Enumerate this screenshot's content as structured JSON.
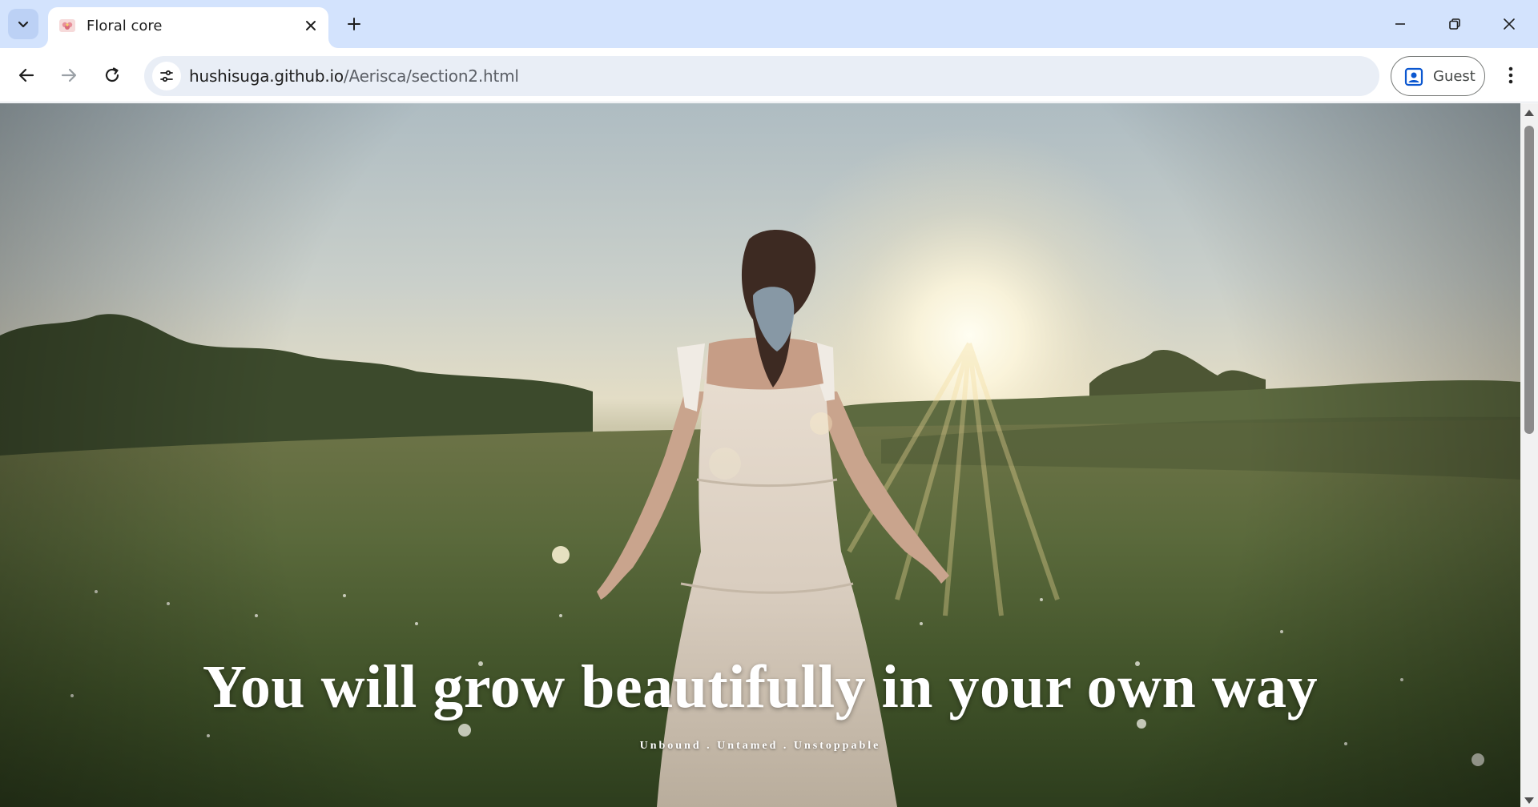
{
  "browser": {
    "tab": {
      "title": "Floral core",
      "favicon": "flower-favicon-icon"
    },
    "new_tab_icon": "plus-icon",
    "tab_search_icon": "chevron-down-icon",
    "window_controls": [
      "minimize-icon",
      "restore-icon",
      "close-icon"
    ],
    "address": {
      "host": "hushisuga.github.io",
      "path": "/Aerisca/section2.html"
    },
    "profile_label": "Guest",
    "colors": {
      "tabstrip": "#d3e3fd",
      "omnibox": "#e9eef6"
    }
  },
  "page": {
    "hero": {
      "heading": "You will grow beautifully in your own way",
      "subtitle": "Unbound . Untamed . Unstoppable",
      "image": "woman-in-white-dress-walking-in-sunlit-meadow"
    }
  },
  "scrollbar": {
    "position_fraction": 0.0
  }
}
